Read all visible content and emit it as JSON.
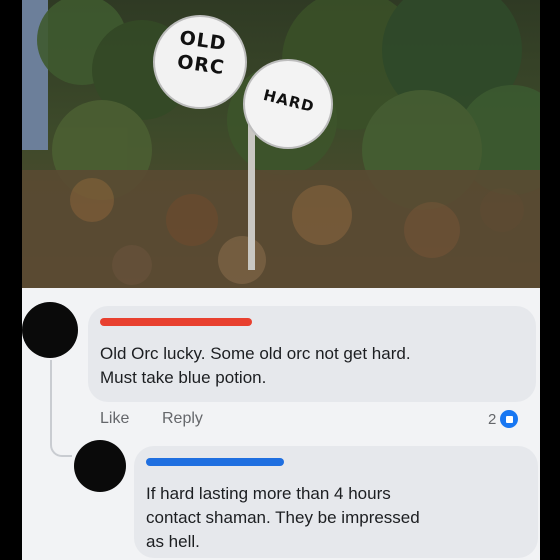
{
  "photo": {
    "sign_left_text_line1": "OLD",
    "sign_left_text_line2": "ORC",
    "sign_right_text": "HARD"
  },
  "comments": [
    {
      "author_redacted": true,
      "text_line1": "Old Orc lucky. Some old orc not get hard.",
      "text_line2": "Must take blue potion.",
      "like_label": "Like",
      "reply_label": "Reply",
      "reaction_count": "2"
    },
    {
      "author_redacted": true,
      "text_line1": "If hard lasting more than 4 hours",
      "text_line2": "contact shaman. They be impressed",
      "text_line3": "as hell."
    }
  ],
  "colors": {
    "redact_red": "#e8402f",
    "redact_blue": "#1f6fe0",
    "accent_blue": "#1877f2"
  }
}
